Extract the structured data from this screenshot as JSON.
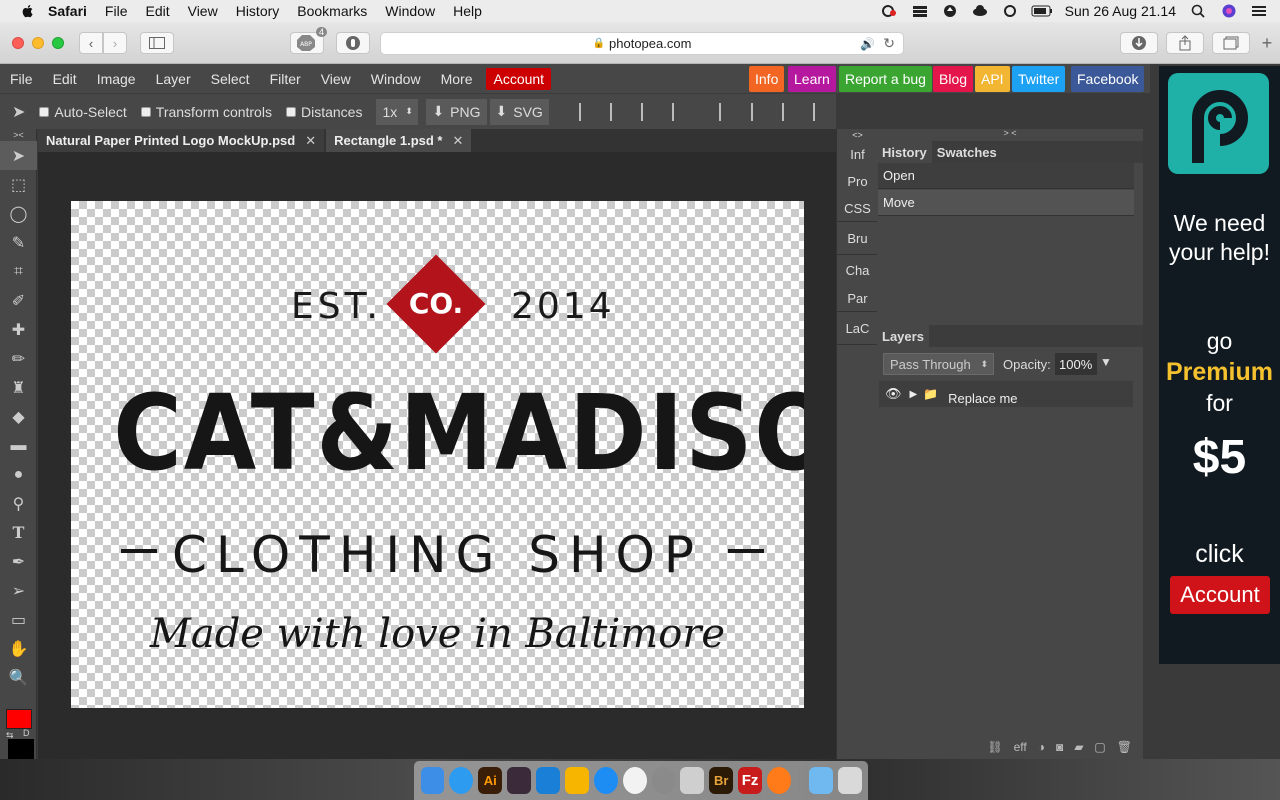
{
  "macbar": {
    "app": "Safari",
    "menus": [
      "File",
      "Edit",
      "View",
      "History",
      "Bookmarks",
      "Window",
      "Help"
    ],
    "clock": "Sun 26 Aug  21.14"
  },
  "safari": {
    "url": "photopea.com",
    "adblock_count": "4"
  },
  "ppmenu": {
    "items": [
      "File",
      "Edit",
      "Image",
      "Layer",
      "Select",
      "Filter",
      "View",
      "Window",
      "More"
    ],
    "account": "Account"
  },
  "links": [
    {
      "label": "Info",
      "color": "#f26522"
    },
    {
      "label": "Learn",
      "color": "#b5179e"
    },
    {
      "label": "Report a bug",
      "color": "#3aa531"
    },
    {
      "label": "Blog",
      "color": "#e3154a"
    },
    {
      "label": "API",
      "color": "#f2b632"
    },
    {
      "label": "Twitter",
      "color": "#1da1f2"
    },
    {
      "label": "Facebook",
      "color": "#3b5998"
    }
  ],
  "options": {
    "auto_select": "Auto-Select",
    "transform": "Transform controls",
    "distances": "Distances",
    "zoom": "1x",
    "png": "PNG",
    "svg": "SVG"
  },
  "tabs": [
    {
      "label": "Natural Paper Printed Logo MockUp.psd",
      "active": false
    },
    {
      "label": "Rectangle 1.psd *",
      "active": true
    }
  ],
  "logo": {
    "est": "EST.",
    "co": "CO.",
    "year": "2014",
    "name": "CAT&MADISON",
    "shop": "CLOTHING SHOP",
    "script": "Made with love in Baltimore"
  },
  "colors": {
    "foreground": "#ff0000",
    "background": "#000000"
  },
  "mini_panel": [
    "Inf",
    "Pro",
    "CSS",
    "Bru",
    "Cha",
    "Par",
    "LaC"
  ],
  "history": {
    "tabs": [
      "History",
      "Swatches"
    ],
    "items": [
      "Open",
      "Move"
    ]
  },
  "layers": {
    "title": "Layers",
    "blend": "Pass Through",
    "opacity_label": "Opacity:",
    "opacity_value": "100%",
    "items": [
      {
        "name": "Replace me",
        "type": "group",
        "visible": true
      }
    ],
    "footer_eff": "eff"
  },
  "ad": {
    "line1": "We need your help!",
    "line2": "go",
    "line3": "Premium",
    "line4": "for",
    "price": "$5",
    "line5": "click",
    "button": "Account"
  }
}
